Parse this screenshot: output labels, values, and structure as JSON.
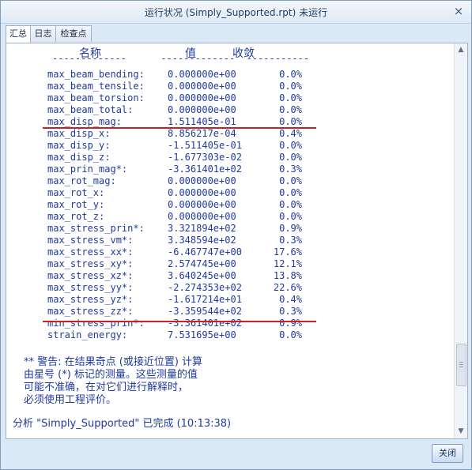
{
  "window": {
    "title": "运行状况 (Simply_Supported.rpt) 未运行",
    "close_glyph": "×"
  },
  "tabs": [
    {
      "label": "汇总",
      "active": true
    },
    {
      "label": "日志",
      "active": false
    },
    {
      "label": "检查点",
      "active": false
    }
  ],
  "table": {
    "header": {
      "name": "名称",
      "value": "值",
      "convergence": "收敛"
    },
    "dashes": "-------------      -------------  -----------",
    "rows": [
      {
        "name": "max_beam_bending:",
        "value": "0.000000e+00",
        "conv": "0.0%"
      },
      {
        "name": "max_beam_tensile:",
        "value": "0.000000e+00",
        "conv": "0.0%"
      },
      {
        "name": "max_beam_torsion:",
        "value": "0.000000e+00",
        "conv": "0.0%"
      },
      {
        "name": "max_beam_total:",
        "value": "0.000000e+00",
        "conv": "0.0%"
      },
      {
        "name": "max_disp_mag:",
        "value": "1.511405e-01",
        "conv": "0.0%"
      },
      {
        "name": "max_disp_x:",
        "value": "8.856217e-04",
        "conv": "0.4%"
      },
      {
        "name": "max_disp_y:",
        "value": "-1.511405e-01",
        "conv": "0.0%"
      },
      {
        "name": "max_disp_z:",
        "value": "-1.677303e-02",
        "conv": "0.0%"
      },
      {
        "name": "max_prin_mag*:",
        "value": "-3.361401e+02",
        "conv": "0.3%"
      },
      {
        "name": "max_rot_mag:",
        "value": "0.000000e+00",
        "conv": "0.0%"
      },
      {
        "name": "max_rot_x:",
        "value": "0.000000e+00",
        "conv": "0.0%"
      },
      {
        "name": "max_rot_y:",
        "value": "0.000000e+00",
        "conv": "0.0%"
      },
      {
        "name": "max_rot_z:",
        "value": "0.000000e+00",
        "conv": "0.0%"
      },
      {
        "name": "max_stress_prin*:",
        "value": "3.321894e+02",
        "conv": "0.9%"
      },
      {
        "name": "max_stress_vm*:",
        "value": "3.348594e+02",
        "conv": "0.3%"
      },
      {
        "name": "max_stress_xx*:",
        "value": "-6.467747e+00",
        "conv": "17.6%"
      },
      {
        "name": "max_stress_xy*:",
        "value": "2.574745e+00",
        "conv": "12.1%"
      },
      {
        "name": "max_stress_xz*:",
        "value": "3.640245e+00",
        "conv": "13.8%"
      },
      {
        "name": "max_stress_yy*:",
        "value": "-2.274353e+02",
        "conv": "22.6%"
      },
      {
        "name": "max_stress_yz*:",
        "value": "-1.617214e+01",
        "conv": "0.4%"
      },
      {
        "name": "max_stress_zz*:",
        "value": "-3.359544e+02",
        "conv": "0.3%"
      },
      {
        "name": "min_stress_prin*:",
        "value": "-3.361401e+02",
        "conv": "0.9%"
      },
      {
        "name": "strain_energy:",
        "value": "7.531695e+00",
        "conv": "0.0%"
      }
    ]
  },
  "note": {
    "line1": "** 警告: 在结果奇点 (或接近位置) 计算",
    "line2": "由星号 (*) 标记的测量。这些测量的值",
    "line3": "可能不准确，在对它们进行解释时，",
    "line4": "必须使用工程评价。"
  },
  "status_text": "分析 \"Simply_Supported\" 已完成 (10:13:38)",
  "footer": {
    "close_label": "关闭"
  },
  "colors": {
    "text": "#1f3a9e",
    "underline": "#cc2020"
  }
}
